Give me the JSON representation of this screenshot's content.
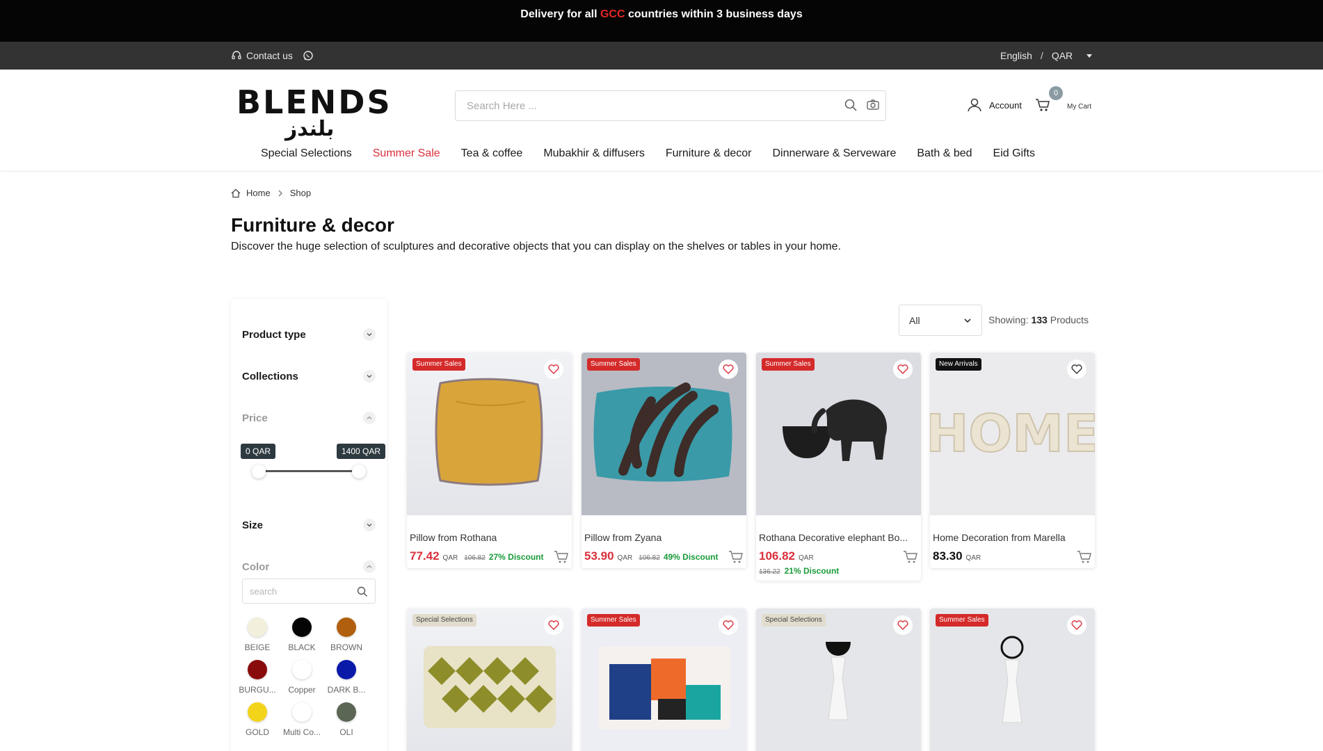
{
  "announcement": {
    "prefix": "Delivery for all ",
    "highlight": "GCC",
    "suffix": " countries within 3 business days"
  },
  "utility": {
    "contact_label": "Contact us",
    "language": "English",
    "separator": "/",
    "currency": "QAR"
  },
  "header": {
    "logo_en": "BLENDS",
    "logo_ar": "بلندز",
    "search_placeholder": "Search Here ...",
    "account_label": "Account",
    "cart_count": "0",
    "cart_label": "My Cart"
  },
  "nav": [
    {
      "label": "Special Selections",
      "highlight": false
    },
    {
      "label": "Summer Sale",
      "highlight": true
    },
    {
      "label": "Tea & coffee",
      "highlight": false
    },
    {
      "label": "Mubakhir & diffusers",
      "highlight": false
    },
    {
      "label": "Furniture & decor",
      "highlight": false
    },
    {
      "label": "Dinnerware & Serveware",
      "highlight": false
    },
    {
      "label": "Bath & bed",
      "highlight": false
    },
    {
      "label": "Eid Gifts",
      "highlight": false
    }
  ],
  "breadcrumb": {
    "home": "Home",
    "current": "Shop"
  },
  "page": {
    "title": "Furniture & decor",
    "description": "Discover the huge selection of sculptures and decorative objects that you can display on the shelves or tables in your home."
  },
  "filters": {
    "product_type": "Product type",
    "collections": "Collections",
    "price": "Price",
    "price_min": "0 QAR",
    "price_max": "1400 QAR",
    "size": "Size",
    "color": "Color",
    "color_search_placeholder": "search",
    "colors": [
      {
        "name": "BEIGE",
        "hex": "#f2f0dc"
      },
      {
        "name": "BLACK",
        "hex": "#050505"
      },
      {
        "name": "BROWN",
        "hex": "#b05f0e"
      },
      {
        "name": "BURGU...",
        "hex": "#8a0b0b"
      },
      {
        "name": "Copper",
        "hex": "#ffffff"
      },
      {
        "name": "DARK B...",
        "hex": "#0a1aa8"
      },
      {
        "name": "GOLD",
        "hex": "#f4d41a"
      },
      {
        "name": "Multi Co...",
        "hex": "#ffffff"
      },
      {
        "name": "OLI",
        "hex": "#5b6655"
      }
    ]
  },
  "toolbar": {
    "sort_value": "All",
    "showing_prefix": "Showing:",
    "showing_count": "133",
    "showing_suffix": "Products"
  },
  "products": [
    {
      "tag": "Summer Sales",
      "tag_style": "red",
      "name": "Pillow from Rothana",
      "price": "77.42",
      "currency": "QAR",
      "old_price": "106.82",
      "discount": "27% Discount"
    },
    {
      "tag": "Summer Sales",
      "tag_style": "red",
      "name": "Pillow from Zyana",
      "price": "53.90",
      "currency": "QAR",
      "old_price": "106.82",
      "discount": "49% Discount"
    },
    {
      "tag": "Summer Sales",
      "tag_style": "red",
      "name": "Rothana Decorative elephant Bo...",
      "price": "106.82",
      "currency": "QAR",
      "old_price": "136.22",
      "discount": "21% Discount"
    },
    {
      "tag": "New Arrivals",
      "tag_style": "black",
      "name": "Home Decoration from Marella",
      "price": "83.30",
      "currency": "QAR",
      "old_price": "",
      "discount": ""
    },
    {
      "tag": "Special Selections",
      "tag_style": "grey"
    },
    {
      "tag": "Summer Sales",
      "tag_style": "red"
    },
    {
      "tag": "Special Selections",
      "tag_style": "grey"
    },
    {
      "tag": "Summer Sales",
      "tag_style": "red"
    }
  ]
}
